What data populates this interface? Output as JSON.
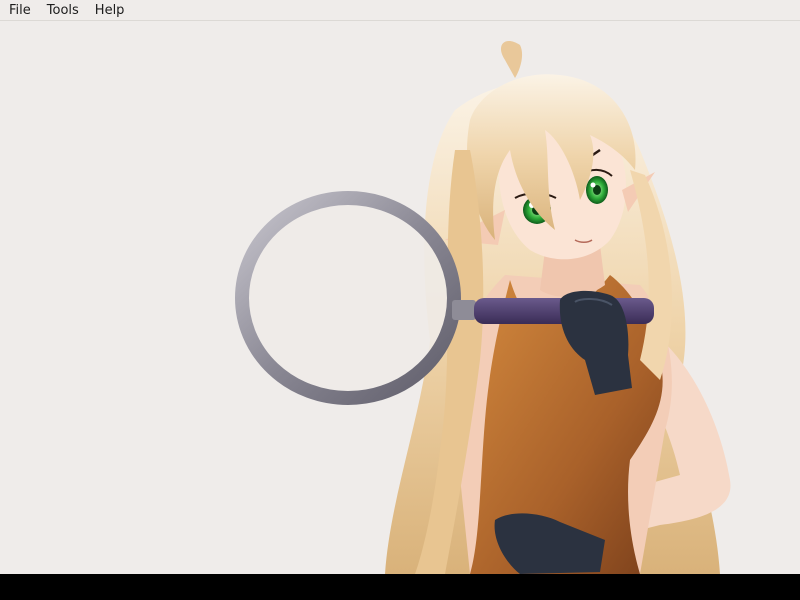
{
  "menu": {
    "items": [
      "File",
      "Tools",
      "Help"
    ]
  },
  "colors": {
    "background": "#efecea",
    "menubar_border": "#dcd9d5",
    "bottom_bar": "#000000",
    "hair": "#e9c89a",
    "skin": "#f6d9c8",
    "eyes": "#2fae3a",
    "dress": "#b26a2b",
    "gloves": "#2b3240",
    "magnifier_rim": "#8e8c97",
    "magnifier_handle": "#4a3a6a"
  },
  "canvas": {
    "content": "anime-girl-with-magnifying-glass-illustration"
  }
}
